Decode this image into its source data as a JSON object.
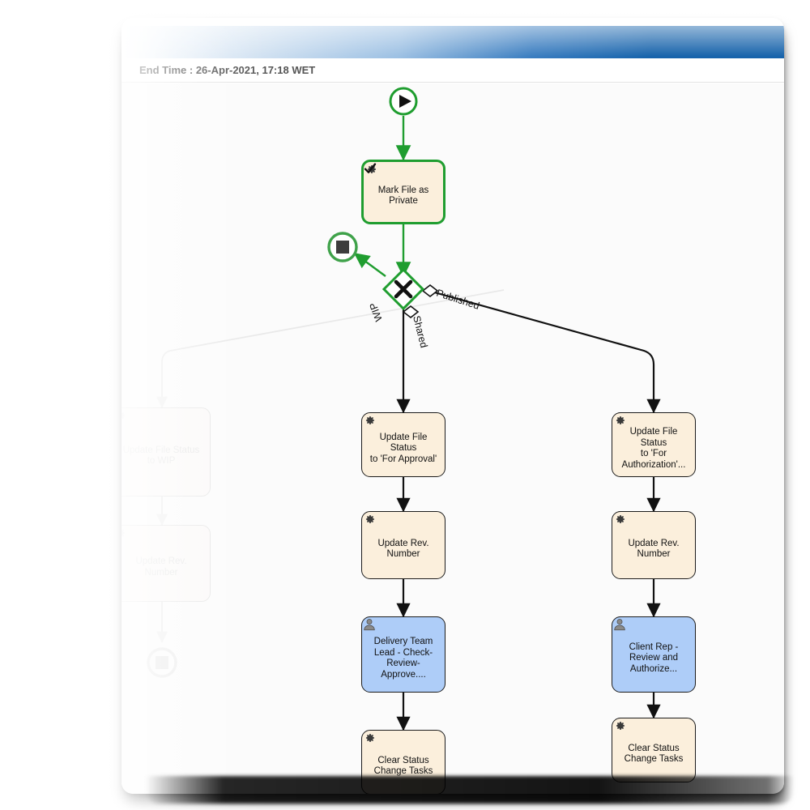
{
  "header": {
    "end_time_label": "End Time :",
    "end_time_value": "26-Apr-2021, 17:18 WET",
    "end_time_full": "End Time : 26-Apr-2021, 17:18 WET"
  },
  "colors": {
    "titlebar_blue": "#1763ab",
    "service_task_fill": "#fbefdc",
    "user_task_fill": "#aecdf8",
    "active_path_green": "#1f9d2f",
    "node_border": "#1c1c1c",
    "canvas_bg": "#fbfbfb"
  },
  "diagram": {
    "type": "bpmn-process-flow",
    "start_event": {
      "name": "start-event",
      "icon": "play-triangle-icon",
      "state": "completed"
    },
    "gateway": {
      "name": "exclusive-gateway",
      "icon": "x-cross-icon",
      "type": "exclusive",
      "state": "completed",
      "outgoing": [
        {
          "label": "WIP",
          "state": "not-taken"
        },
        {
          "label": "Shared",
          "state": "not-taken"
        },
        {
          "label": "Published",
          "state": "not-taken"
        }
      ]
    },
    "end_events": [
      {
        "name": "terminate-end-event-active",
        "icon": "filled-square-icon",
        "state": "completed"
      },
      {
        "name": "terminate-end-event-wip",
        "icon": "filled-square-icon",
        "state": "inactive"
      }
    ],
    "nodes": {
      "mark_file_private": {
        "label": "Mark File as\nPrivate",
        "icon": "gear-icon",
        "badge": "check-icon",
        "kind": "service",
        "state": "completed"
      },
      "wip_update_status": {
        "label": "Update File Status\nto WIP",
        "icon": "gear-icon",
        "kind": "service",
        "state": "inactive"
      },
      "wip_update_rev": {
        "label": "Update Rev.\nNumber",
        "icon": "gear-icon",
        "kind": "service",
        "state": "inactive"
      },
      "shared_update_status": {
        "label": "Update File Status\nto 'For Approval'",
        "icon": "gear-icon",
        "kind": "service",
        "state": "pending"
      },
      "shared_update_rev": {
        "label": "Update Rev.\nNumber",
        "icon": "gear-icon",
        "kind": "service",
        "state": "pending"
      },
      "shared_user_task": {
        "label": "Delivery Team\nLead - Check-\nReview-Approve....",
        "icon": "user-icon",
        "kind": "user",
        "state": "pending"
      },
      "shared_clear_tasks": {
        "label": "Clear Status\nChange Tasks",
        "icon": "gear-icon",
        "kind": "service",
        "state": "pending"
      },
      "published_update_status": {
        "label": "Update File Status\nto 'For\nAuthorization'...",
        "icon": "gear-icon",
        "kind": "service",
        "state": "pending"
      },
      "published_update_rev": {
        "label": "Update Rev.\nNumber",
        "icon": "gear-icon",
        "kind": "service",
        "state": "pending"
      },
      "published_user_task": {
        "label": "Client Rep -\nReview and\nAuthorize...",
        "icon": "user-icon",
        "kind": "user",
        "state": "pending"
      },
      "published_clear_tasks": {
        "label": "Clear Status\nChange Tasks",
        "icon": "gear-icon",
        "kind": "service",
        "state": "pending"
      }
    }
  }
}
